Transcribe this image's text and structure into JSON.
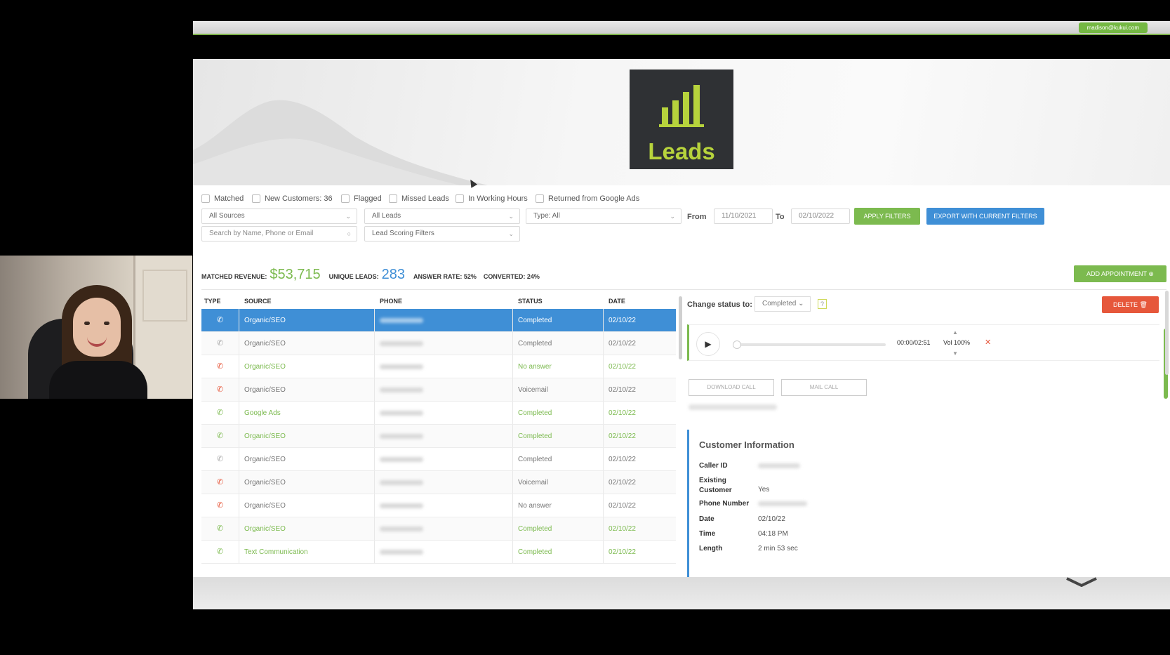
{
  "user_email": "madison@kukui.com",
  "logo": {
    "title": "Leads"
  },
  "filters": {
    "checkboxes": [
      "Matched",
      "New Customers: 36",
      "Flagged",
      "Missed Leads",
      "In Working Hours",
      "Returned from Google Ads"
    ],
    "source_select": "All Sources",
    "leads_select": "All Leads",
    "type_select": "Type: All",
    "search_placeholder": "Search by Name, Phone or Email",
    "scoring_select": "Lead Scoring Filters",
    "from_label": "From",
    "from_date": "11/10/2021",
    "to_label": "To",
    "to_date": "02/10/2022",
    "apply_label": "APPLY FILTERS",
    "export_label": "EXPORT WITH CURRENT FILTERS"
  },
  "stats": {
    "revenue_label": "MATCHED REVENUE:",
    "revenue_value": "$53,715",
    "unique_label": "UNIQUE LEADS:",
    "unique_value": "283",
    "answer_label": "ANSWER RATE: 52%",
    "converted_label": "CONVERTED: 24%",
    "add_appointment": "ADD APPOINTMENT"
  },
  "table": {
    "headers": [
      "TYPE",
      "SOURCE",
      "PHONE",
      "STATUS",
      "DATE"
    ],
    "rows": [
      {
        "type": "call",
        "source": "Organic/SEO",
        "status": "Completed",
        "date": "02/10/22",
        "tone": "selected"
      },
      {
        "type": "call",
        "source": "Organic/SEO",
        "status": "Completed",
        "date": "02/10/22",
        "tone": "gray"
      },
      {
        "type": "missed",
        "source": "Organic/SEO",
        "status": "No answer",
        "date": "02/10/22",
        "tone": "green"
      },
      {
        "type": "missed",
        "source": "Organic/SEO",
        "status": "Voicemail",
        "date": "02/10/22",
        "tone": "gray"
      },
      {
        "type": "call",
        "source": "Google Ads",
        "status": "Completed",
        "date": "02/10/22",
        "tone": "green"
      },
      {
        "type": "call",
        "source": "Organic/SEO",
        "status": "Completed",
        "date": "02/10/22",
        "tone": "green"
      },
      {
        "type": "call",
        "source": "Organic/SEO",
        "status": "Completed",
        "date": "02/10/22",
        "tone": "gray"
      },
      {
        "type": "missed",
        "source": "Organic/SEO",
        "status": "Voicemail",
        "date": "02/10/22",
        "tone": "gray"
      },
      {
        "type": "missed",
        "source": "Organic/SEO",
        "status": "No answer",
        "date": "02/10/22",
        "tone": "gray"
      },
      {
        "type": "call",
        "source": "Organic/SEO",
        "status": "Completed",
        "date": "02/10/22",
        "tone": "green"
      },
      {
        "type": "call",
        "source": "Text Communication",
        "status": "Completed",
        "date": "02/10/22",
        "tone": "green"
      }
    ]
  },
  "panel": {
    "change_status_label": "Change status to:",
    "status_value": "Completed",
    "help": "?",
    "delete_label": "DELETE",
    "player_time": "00:00/02:51",
    "player_vol": "Vol 100%",
    "download_label": "DOWNLOAD CALL",
    "mail_label": "MAIL CALL",
    "customer_info_title": "Customer Information",
    "fields": [
      {
        "label": "Caller ID",
        "value": ""
      },
      {
        "label": "Existing Customer",
        "value": "Yes"
      },
      {
        "label": "Phone Number",
        "value": ""
      },
      {
        "label": "Date",
        "value": "02/10/22"
      },
      {
        "label": "Time",
        "value": "04:18 PM"
      },
      {
        "label": "Length",
        "value": "2 min 53 sec"
      }
    ]
  },
  "colors": {
    "green": "#7cba4f",
    "blue": "#3f8fd6",
    "red": "#e6573b",
    "logo_bg": "#2f3134",
    "logo_accent": "#b7d33c"
  }
}
